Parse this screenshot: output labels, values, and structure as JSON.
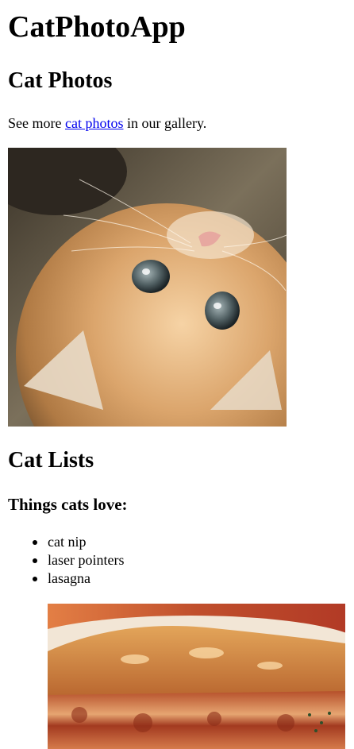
{
  "page": {
    "title": "CatPhotoApp"
  },
  "photos_section": {
    "heading": "Cat Photos",
    "lead_prefix": "See more ",
    "lead_link": "cat photos",
    "lead_suffix": " in our gallery.",
    "image_alt": "A cute orange cat lying on its back."
  },
  "lists_section": {
    "heading": "Cat Lists",
    "subheading": "Things cats love:",
    "items": [
      "cat nip",
      "laser pointers",
      "lasagna"
    ],
    "image_alt": "A slice of lasagna on a plate."
  },
  "colors": {
    "link": "#0000ee",
    "text": "#000000",
    "background": "#ffffff"
  }
}
